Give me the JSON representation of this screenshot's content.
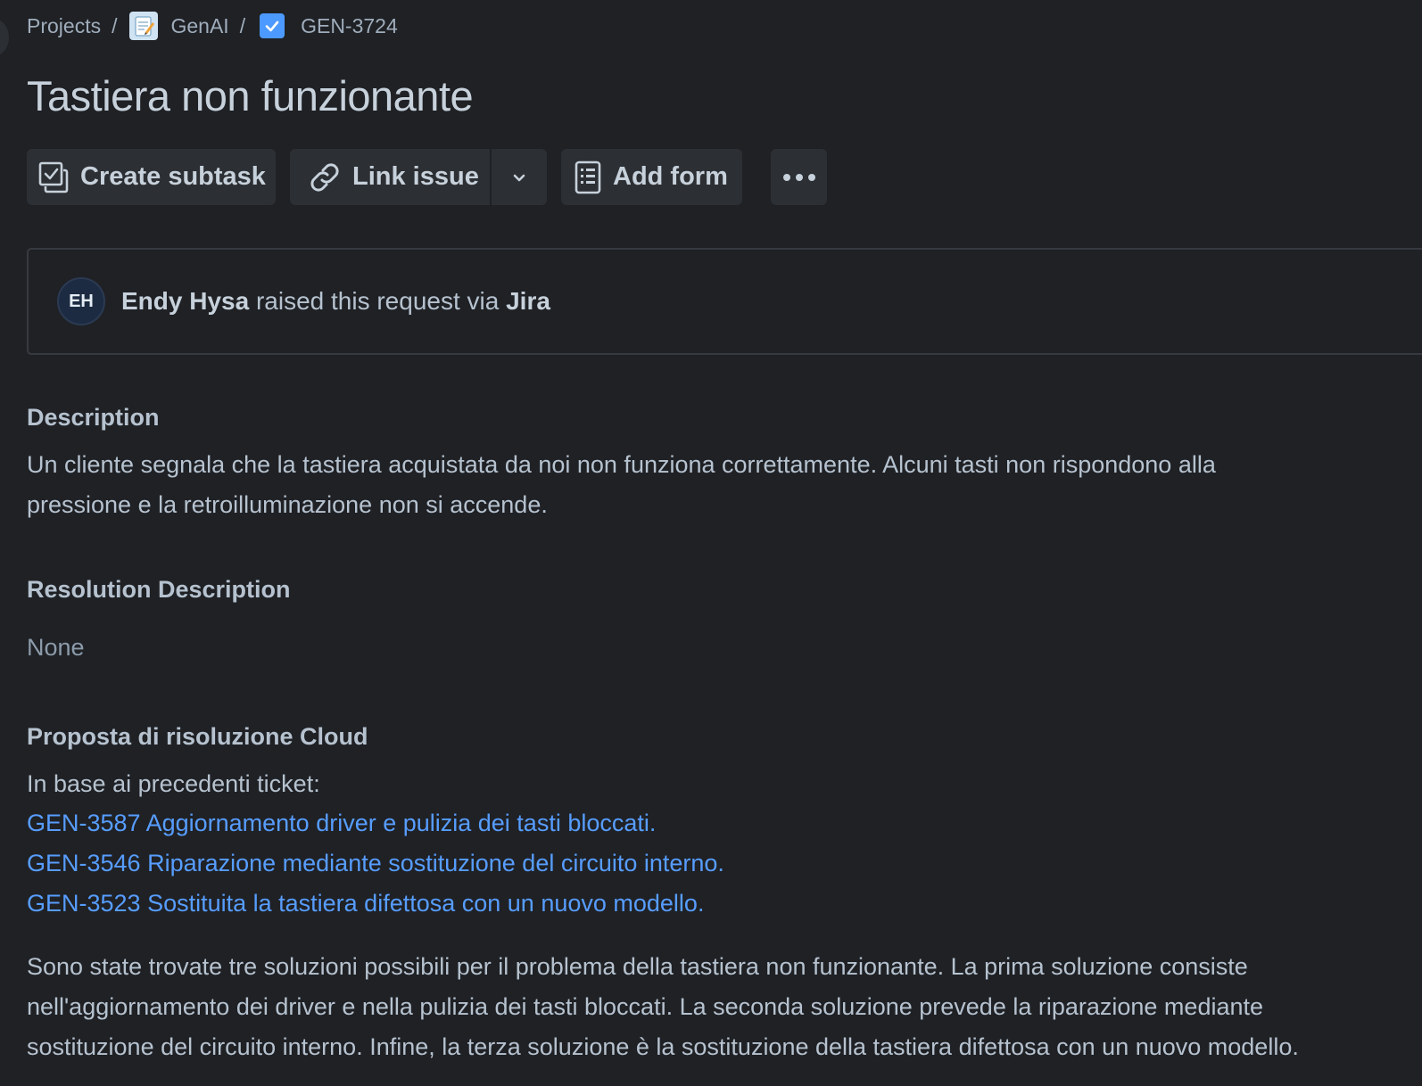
{
  "breadcrumb": {
    "projects": "Projects",
    "separator": "/",
    "project": "GenAI",
    "issue_key": "GEN-3724"
  },
  "issue": {
    "title": "Tastiera non funzionante"
  },
  "toolbar": {
    "create_subtask": "Create subtask",
    "link_issue": "Link issue",
    "add_form": "Add form"
  },
  "request": {
    "avatar_initials": "EH",
    "reporter": "Endy Hysa",
    "middle_text": " raised this request via ",
    "channel": "Jira"
  },
  "description": {
    "heading": "Description",
    "line1": "Un cliente segnala che la tastiera acquistata da noi non funziona correttamente. Alcuni tasti non rispondono alla",
    "line2": "pressione e la retroilluminazione non si accende."
  },
  "resolution": {
    "heading": "Resolution Description",
    "value": "None"
  },
  "proposal": {
    "heading": "Proposta di risoluzione Cloud",
    "intro": "In base ai precedenti ticket:",
    "links": [
      "GEN-3587 Aggiornamento driver e pulizia dei tasti bloccati.",
      "GEN-3546 Riparazione mediante sostituzione del circuito interno.",
      "GEN-3523 Sostituita la tastiera difettosa con un nuovo modello."
    ],
    "summary_lines": [
      "Sono state trovate tre soluzioni possibili per il problema della tastiera non funzionante. La prima soluzione consiste",
      "nell'aggiornamento dei driver e nella pulizia dei tasti bloccati. La seconda soluzione prevede la riparazione mediante",
      "sostituzione del circuito interno. Infine, la terza soluzione è la sostituzione della tastiera difettosa con un nuovo modello."
    ]
  },
  "colors": {
    "background": "#1f2125",
    "text": "#b6c2cf",
    "link": "#579dff",
    "button_bg": "#2c2f33"
  }
}
